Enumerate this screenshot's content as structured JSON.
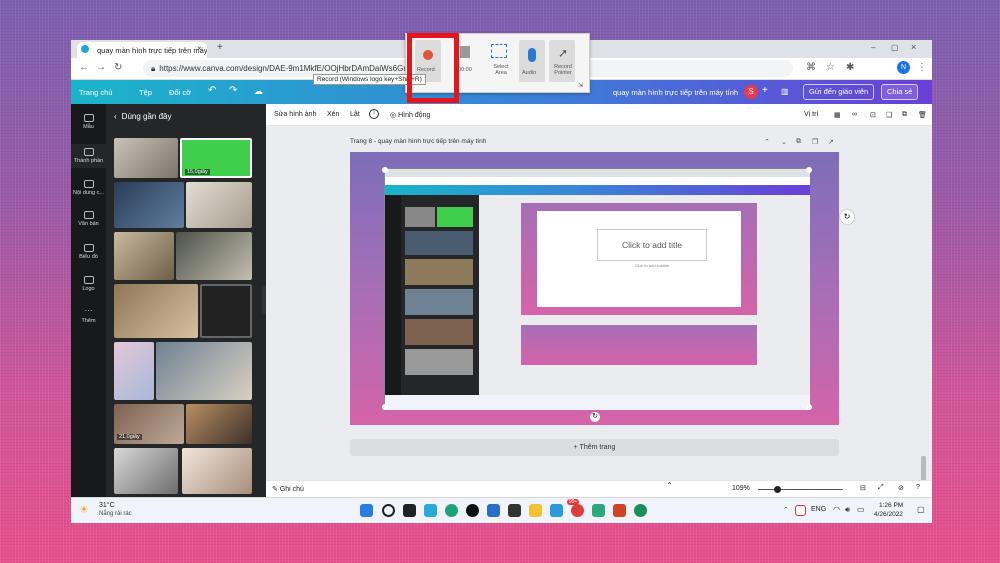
{
  "browser": {
    "tab_title": "quay màn hình trực tiếp trên máy...",
    "url": "https://www.canva.com/design/DAE-9m1MkfE/OOjHbrDAmDaiWs6GuPW"
  },
  "canva_bar": {
    "home": "Trang chủ",
    "file": "Tệp",
    "resize": "Đổi cỡ",
    "doc_title": "quay màn hình trực tiếp trên máy tính",
    "send_teacher": "Gửi đến giáo viên",
    "share": "Chia sẻ"
  },
  "rail": [
    {
      "label": "Mẫu"
    },
    {
      "label": "Thành phần"
    },
    {
      "label": "Nội dung c..."
    },
    {
      "label": "Văn bản"
    },
    {
      "label": "Biểu đồ"
    },
    {
      "label": "Logo"
    },
    {
      "label": "Thêm"
    }
  ],
  "panel": {
    "back_label": "Dùng gần đây",
    "badge1": "15,0giây",
    "badge2": "21,0giây"
  },
  "editor_toolbar": {
    "edit_image": "Sửa hình ảnh",
    "crop": "Xén",
    "flip": "Lật",
    "animate": "Hình động",
    "position": "Vị trí"
  },
  "page": {
    "title": "Trang 8 - quay màn hình trực tiếp trên máy tính",
    "add_page": "+ Thêm trang",
    "slide_placeholder": "Click to add title",
    "slide_sub": "Click to add subtitle"
  },
  "bottom": {
    "notes": "Ghi chú",
    "zoom": "109%"
  },
  "taskbar": {
    "temp": "31°C",
    "weather": "Nắng rải rác",
    "lang": "ENG",
    "time": "1:26 PM",
    "date": "4/26/2022",
    "badge": "99+"
  },
  "recorder": {
    "record": "Record",
    "time": "00:00",
    "select_area": "Select Area",
    "audio": "Audio",
    "record_pointer": "Record Pointer",
    "tooltip": "Record (Windows logo key+Shift+R)"
  }
}
